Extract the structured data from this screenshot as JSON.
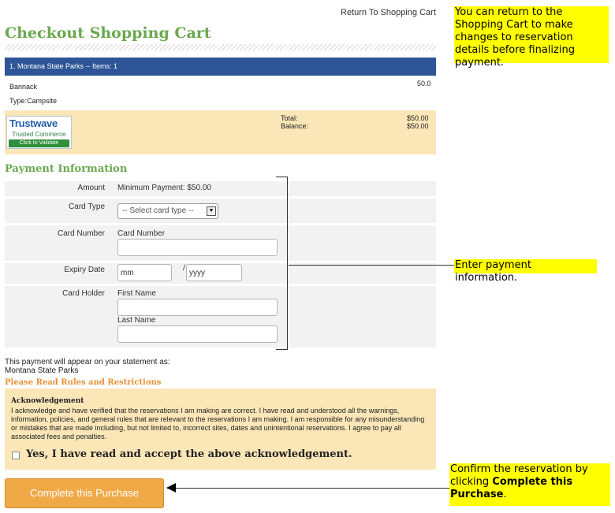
{
  "header": {
    "return_link": "Return To Shopping Cart",
    "title": "Checkout Shopping Cart"
  },
  "cart": {
    "section_header": "1. Montana State Parks -- Items: 1",
    "item_name": "Bannack",
    "item_price": "50.0",
    "item_type": "Type:Campsite",
    "trustwave": {
      "name": "Trustwave",
      "sub": "Trusted Commerce",
      "button": "Click to Validate"
    },
    "total_label": "Total:",
    "total_value": "$50.00",
    "balance_label": "Balance:",
    "balance_value": "$50.00"
  },
  "payment": {
    "title": "Payment Information",
    "amount_label": "Amount",
    "amount_value": "Minimum Payment: $50.00",
    "card_type_label": "Card Type",
    "card_type_selected": "-- Select card type --",
    "card_number_label": "Card Number",
    "card_number_sub_label": "Card Number",
    "expiry_label": "Expiry Date",
    "expiry_month": "mm",
    "expiry_sep": "/",
    "expiry_year": "yyyy",
    "card_holder_label": "Card Holder",
    "first_name_label": "First Name",
    "last_name_label": "Last Name"
  },
  "statement": {
    "line1": "This payment will appear on your statement as:",
    "line2": "Montana State Parks"
  },
  "rules_link": "Please Read Rules and Restrictions",
  "acknowledgement": {
    "title": "Acknowledgement",
    "text": "I acknowledge and have verified that the reservations I am making are correct. I have read and understood all the warnings, information, policies, and general rules that are relevant to the reservations I am making. I am responsible for any misunderstanding or mistakes that are made including, but not limited to, incorrect sites, dates and unintentional reservations. I agree to pay all associated fees and penalties.",
    "checkbox_label": "Yes, I have read and accept the above acknowledgement."
  },
  "purchase_button": "Complete this Purchase",
  "callouts": {
    "return": "You can return to the Shopping Cart to make changes to reservation details before finalizing payment.",
    "payment": "Enter payment information.",
    "confirm_prefix": "Confirm the reservation by clicking ",
    "confirm_bold": "Complete this Purchase",
    "confirm_suffix": "."
  },
  "colors": {
    "header_blue": "#2d5597",
    "title_green": "#6aa84f",
    "band_tan": "#fbe6b8",
    "rules_orange": "#e69138",
    "button_orange": "#f0a947",
    "callout_yellow": "#ffff00"
  }
}
